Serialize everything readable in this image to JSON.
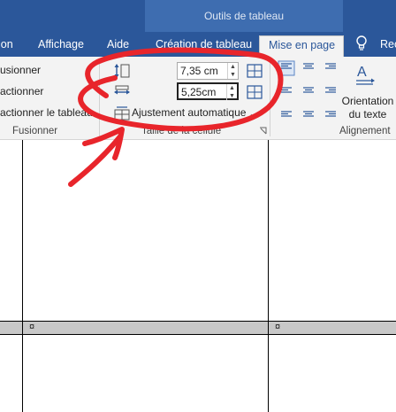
{
  "ribbon_tabs": {
    "context_group": "Outils de tableau",
    "items": [
      {
        "label": "ion",
        "active": false
      },
      {
        "label": "Affichage",
        "active": false
      },
      {
        "label": "Aide",
        "active": false
      },
      {
        "label": "Création de tableau",
        "active": false
      },
      {
        "label": "Mise en page",
        "active": true
      },
      {
        "label": "Rec",
        "active": false
      }
    ]
  },
  "merge_group": {
    "items": [
      "usionner",
      "actionner",
      "actionner le tableau"
    ],
    "label": "Fusionner"
  },
  "cell_size_group": {
    "height_value": "7,35 cm",
    "width_value": "5,25cm",
    "autofit_label": "Ajustement automatique",
    "label": "Taille de la cellule"
  },
  "alignment_group": {
    "text_direction_line1": "Orientation",
    "text_direction_line2": "du texte",
    "label": "Alignement"
  },
  "document": {
    "cell_marks": [
      "¤",
      "¤"
    ]
  },
  "colors": {
    "ribbon_blue": "#2b579a",
    "ribbon_bg": "#f3f3f3",
    "annotation_red": "#e8252b"
  }
}
